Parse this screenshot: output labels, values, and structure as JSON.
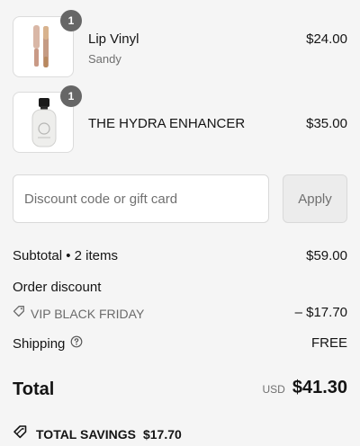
{
  "line_items": [
    {
      "name": "Lip Vinyl",
      "variant": "Sandy",
      "price": "$24.00",
      "quantity": "1",
      "image_icon": "lip-gloss-tube-image"
    },
    {
      "name": "THE HYDRA ENHANCER",
      "variant": "",
      "price": "$35.00",
      "quantity": "1",
      "image_icon": "serum-bottle-image"
    }
  ],
  "discount": {
    "placeholder": "Discount code or gift card",
    "value": "",
    "apply_label": "Apply"
  },
  "summary": {
    "subtotal_label": "Subtotal • 2 items",
    "subtotal_value": "$59.00",
    "order_discount_label": "Order discount",
    "discount_code": "VIP BLACK FRIDAY",
    "discount_value": "– $17.70",
    "shipping_label": "Shipping",
    "shipping_value": "FREE",
    "total_label": "Total",
    "total_currency": "USD",
    "total_value": "$41.30",
    "savings_label": "TOTAL SAVINGS",
    "savings_value": "$17.70"
  },
  "icons": {
    "tag": "tag-icon",
    "help": "help-circle-icon",
    "savings": "tag-icon"
  },
  "colors": {
    "background": "#f5f5f5",
    "badge": "#666666",
    "muted_text": "#707070",
    "apply_button": "#ececec"
  }
}
